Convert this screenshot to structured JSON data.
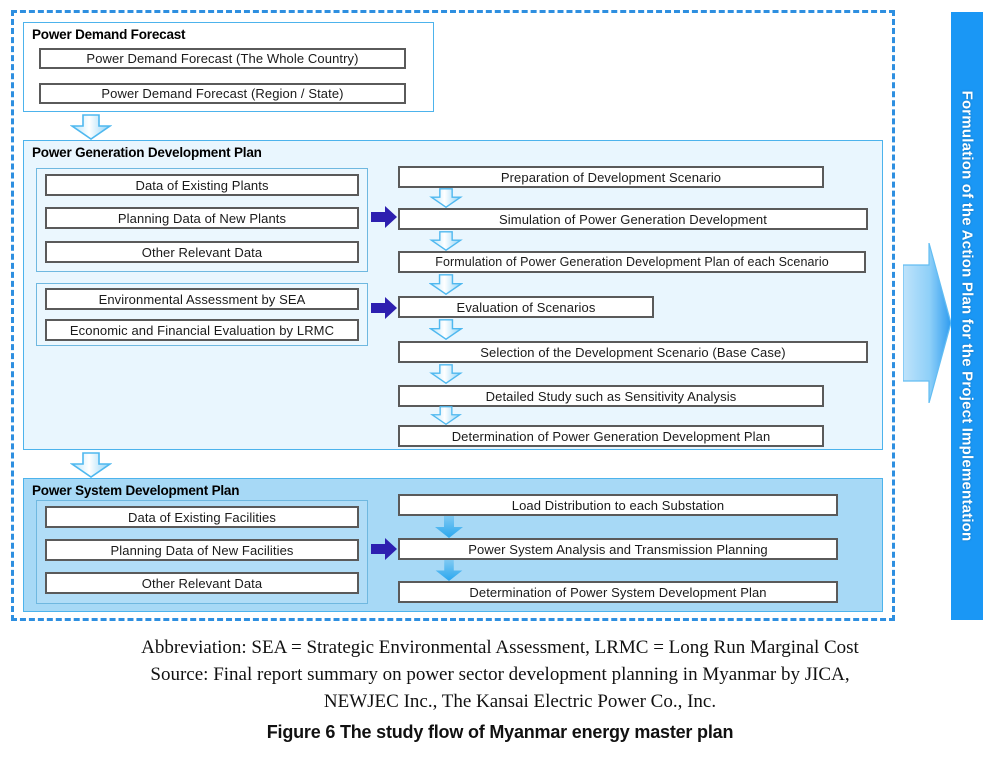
{
  "figure": {
    "abbreviation_line": "Abbreviation: SEA = Strategic Environmental Assessment, LRMC = Long Run Marginal Cost",
    "source_line_1": "Source: Final report summary on power sector development planning in Myanmar by JICA,",
    "source_line_2": "NEWJEC Inc., The Kansai Electric Power Co., Inc.",
    "title": "Figure 6 The study flow of Myanmar energy master plan"
  },
  "action_bar": {
    "label": "Formulation of the Action Plan  for the Project Implementation",
    "color": "#1a97f5"
  },
  "colors": {
    "dashed_border": "#2e8fe0",
    "panel_border": "#4db3ec",
    "generation_fill": "#e9f6fe",
    "system_fill": "#a7d9f6",
    "box_border": "#5a5a5a",
    "purple_arrow": "#2d1fb0",
    "blue_arrow": "#4fb8ef"
  },
  "sections": {
    "demand": {
      "title": "Power Demand Forecast",
      "boxes": [
        "Power Demand  Forecast (The  Whole  Country)",
        "Power Demand  Forecast (Region  / State)"
      ]
    },
    "generation": {
      "title": "Power Generation Development Plan",
      "inputs_group_a": [
        "Data of Existing Plants",
        "Planning  Data of New  Plants",
        "Other Relevant  Data"
      ],
      "inputs_group_b": [
        "Environmental  Assessment by SEA",
        "Economic and Financial Evaluation  by LRMC"
      ],
      "flow": [
        "Preparation  of Development   Scenario",
        "Simulation of Power Generation  Development",
        "Formulation of Power Generation  Development  Plan of each Scenario",
        "Evaluation  of Scenarios",
        "Selection of the Development  Scenario (Base Case)",
        "Detailed Study such as Sensitivity Analysis",
        "Determination of Power Generation  Development  Plan"
      ]
    },
    "system": {
      "title": "Power System Development Plan",
      "inputs": [
        "Data of Existing Facilities",
        "Planning  Data of New Facilities",
        "Other Relevant  Data"
      ],
      "flow": [
        "Load Distribution to each Substation",
        "Power System Analysis and Transmission Planning",
        "Determination of Power System Development  Plan"
      ]
    }
  },
  "icons": {
    "down_arrow": "arrow-down-icon",
    "right_arrow": "arrow-right-icon",
    "big_right_arrow": "big-arrow-right-icon"
  }
}
